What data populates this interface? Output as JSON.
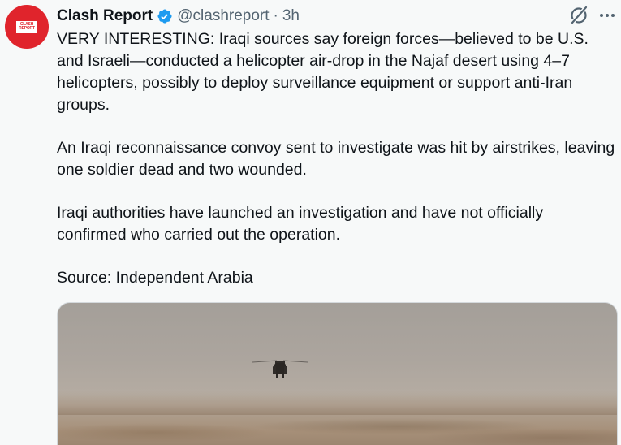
{
  "tweet": {
    "display_name": "Clash Report",
    "handle": "@clashreport",
    "separator": "·",
    "time": "3h",
    "avatar_text": [
      "CLASH",
      "REPORT"
    ],
    "paragraphs": [
      "VERY INTERESTING: Iraqi sources say foreign forces—believed to be U.S. and Israeli—conducted a helicopter air-drop in the Najaf desert using 4–7 helicopters, possibly to deploy surveillance equipment or support anti-Iran groups.",
      "An Iraqi reconnaissance convoy sent to investigate was hit by airstrikes, leaving one soldier dead and two wounded.",
      "Iraqi authorities have launched an investigation and have not officially confirmed who carried out the operation.",
      "Source: Independent Arabia"
    ]
  },
  "icons": {
    "verified": "verified-badge-icon",
    "grok": "grok-icon",
    "more": "more-options-icon"
  },
  "colors": {
    "avatar_bg": "#e0242c",
    "verified": "#1d9bf0",
    "muted_text": "#536471",
    "page_bg": "#f7f9f9"
  }
}
